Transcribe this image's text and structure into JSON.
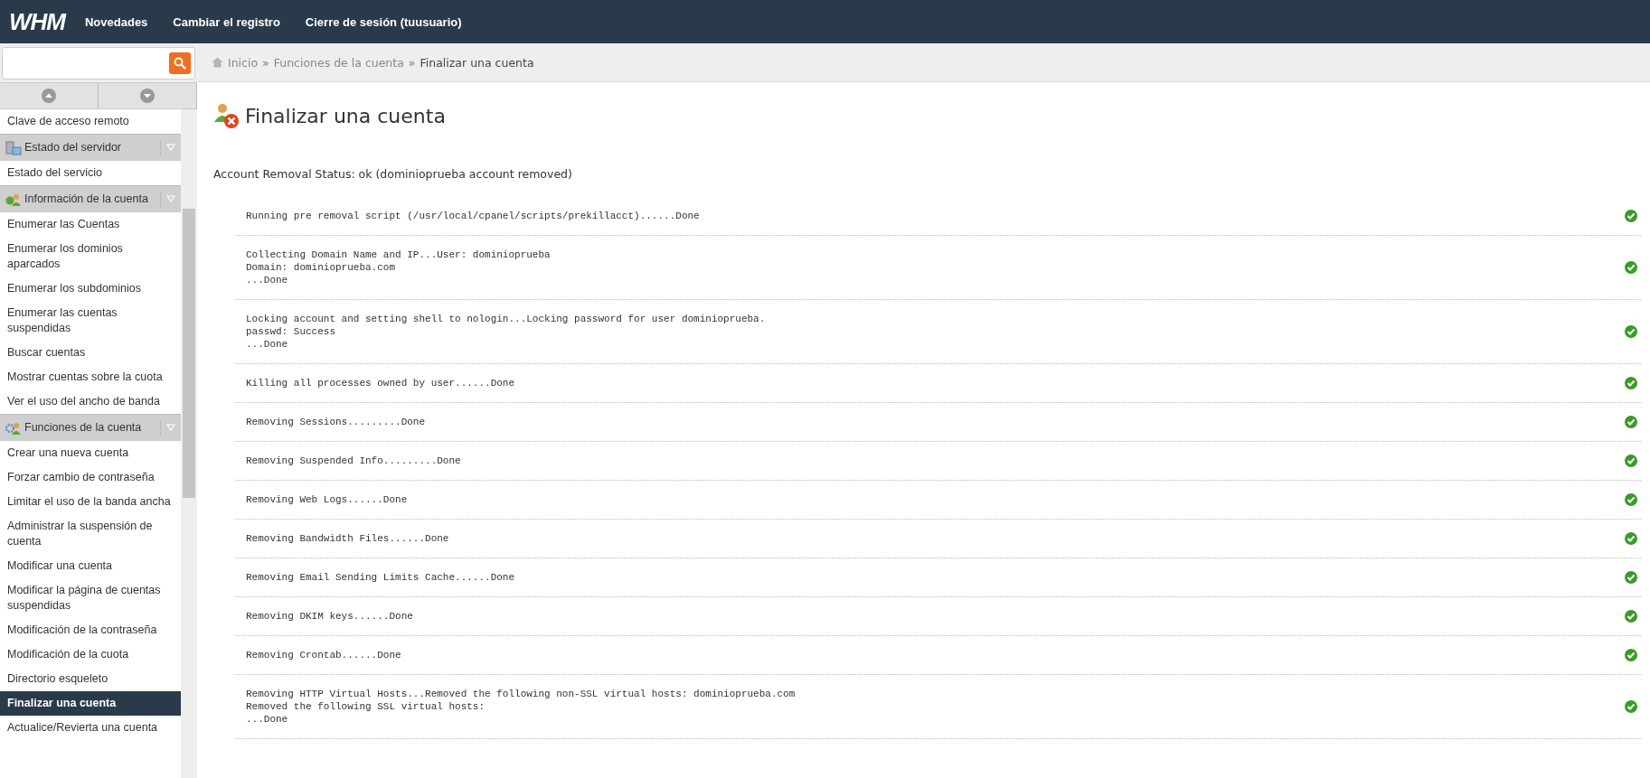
{
  "topbar": {
    "logo": "WHM",
    "links": [
      "Novedades",
      "Cambiar el registro",
      "Cierre de sesión (tuusuario)"
    ]
  },
  "breadcrumb": [
    {
      "label": "Inicio",
      "current": false,
      "kind": "home",
      "separator": "»"
    },
    {
      "label": "Funciones de la cuenta",
      "current": false,
      "kind": "link",
      "separator": "»"
    },
    {
      "label": "Finalizar una cuenta",
      "current": true,
      "kind": "link"
    }
  ],
  "sidebar": {
    "items": [
      {
        "kind": "link",
        "label": "Clave de acceso remoto",
        "selected": false
      },
      {
        "kind": "group",
        "label": "Estado del servidor",
        "selected": false
      },
      {
        "kind": "link",
        "label": "Estado del servicio",
        "selected": false
      },
      {
        "kind": "group",
        "label": "Información de la cuenta",
        "selected": false
      },
      {
        "kind": "link",
        "label": "Enumerar las Cuentas",
        "selected": false
      },
      {
        "kind": "link",
        "label": "Enumerar los dominios aparcados",
        "selected": false
      },
      {
        "kind": "link",
        "label": "Enumerar los subdominios",
        "selected": false
      },
      {
        "kind": "link",
        "label": "Enumerar las cuentas suspendidas",
        "selected": false
      },
      {
        "kind": "link",
        "label": "Buscar cuentas",
        "selected": false
      },
      {
        "kind": "link",
        "label": "Mostrar cuentas sobre la cuota",
        "selected": false
      },
      {
        "kind": "link",
        "label": "Ver el uso del ancho de banda",
        "selected": false
      },
      {
        "kind": "group",
        "label": "Funciones de la cuenta",
        "selected": false
      },
      {
        "kind": "link",
        "label": "Crear una nueva cuenta",
        "selected": false
      },
      {
        "kind": "link",
        "label": "Forzar cambio de contraseña",
        "selected": false
      },
      {
        "kind": "link",
        "label": "Limitar el uso de la banda ancha",
        "selected": false
      },
      {
        "kind": "link",
        "label": "Administrar la suspensión de cuenta",
        "selected": false
      },
      {
        "kind": "link",
        "label": "Modificar una cuenta",
        "selected": false
      },
      {
        "kind": "link",
        "label": "Modificar la página de cuentas suspendidas",
        "selected": false
      },
      {
        "kind": "link",
        "label": "Modificación de la contraseña",
        "selected": false
      },
      {
        "kind": "link",
        "label": "Modificación de la cuota",
        "selected": false
      },
      {
        "kind": "link",
        "label": "Directorio esqueleto",
        "selected": false
      },
      {
        "kind": "link",
        "label": "Finalizar una cuenta",
        "selected": true
      },
      {
        "kind": "link",
        "label": "Actualice/Revierta una cuenta",
        "selected": false
      }
    ]
  },
  "page": {
    "title": "Finalizar una cuenta",
    "status": "Account Removal Status: ok (dominioprueba account removed)",
    "steps": [
      {
        "text": "Running pre removal script (/usr/local/cpanel/scripts/prekillacct)......Done",
        "ok": true
      },
      {
        "text": "Collecting Domain Name and IP...User: dominioprueba\nDomain: dominioprueba.com\n...Done",
        "ok": true
      },
      {
        "text": "Locking account and setting shell to nologin...Locking password for user dominioprueba.\npasswd: Success\n...Done",
        "ok": true
      },
      {
        "text": "Killing all processes owned by user......Done",
        "ok": true
      },
      {
        "text": "Removing Sessions.........Done",
        "ok": true
      },
      {
        "text": "Removing Suspended Info.........Done",
        "ok": true
      },
      {
        "text": "Removing Web Logs......Done",
        "ok": true
      },
      {
        "text": "Removing Bandwidth Files......Done",
        "ok": true
      },
      {
        "text": "Removing Email Sending Limits Cache......Done",
        "ok": true
      },
      {
        "text": "Removing DKIM keys......Done",
        "ok": true
      },
      {
        "text": "Removing Crontab......Done",
        "ok": true
      },
      {
        "text": "Removing HTTP Virtual Hosts...Removed the following non-SSL virtual hosts: dominioprueba.com\nRemoved the following SSL virtual hosts:\n...Done",
        "ok": true
      }
    ]
  }
}
